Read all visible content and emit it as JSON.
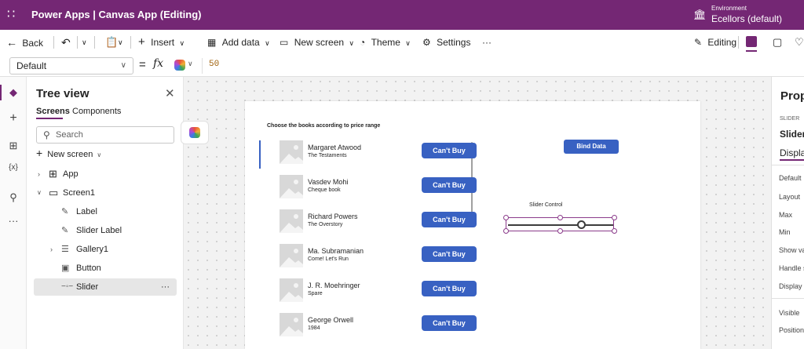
{
  "topbar": {
    "waffle_icon": "app-launcher-icon",
    "title": "Power Apps  |  Canvas App (Editing)",
    "environment_label": "Environment",
    "environment_name": "Ecellors (default)",
    "bg": "#742774"
  },
  "commandbar": {
    "back": "Back",
    "insert": "Insert",
    "add_data": "Add data",
    "new_screen": "New screen",
    "theme": "Theme",
    "settings": "Settings",
    "more": "···",
    "editing": "Editing"
  },
  "formulabar": {
    "property": "Default",
    "equals": "=",
    "fx": "fx",
    "value": "50"
  },
  "treeview": {
    "title": "Tree view",
    "tabs": [
      "Screens",
      "Components"
    ],
    "search_placeholder": "Search",
    "new_screen": "New screen",
    "nodes": [
      {
        "label": "App"
      },
      {
        "label": "Screen1"
      },
      {
        "label": "Label"
      },
      {
        "label": "Slider Label"
      },
      {
        "label": "Gallery1"
      },
      {
        "label": "Button"
      },
      {
        "label": "Slider"
      }
    ],
    "selected_more": "···"
  },
  "app": {
    "heading": "Choose the books according to price range",
    "bind_button": "Bind Data",
    "slider_label": "Slider Control",
    "slider_value_fraction": 0.7,
    "accent": "#3861c2",
    "rows": [
      {
        "author": "Margaret Atwood",
        "book": "The Testaments",
        "button": "Can't Buy"
      },
      {
        "author": "Vasdev Mohi",
        "book": "Cheque book",
        "button": "Can't Buy"
      },
      {
        "author": "Richard Powers",
        "book": "The Overstory",
        "button": "Can't Buy"
      },
      {
        "author": "Ma. Subramanian",
        "book": "Come! Let's Run",
        "button": "Can't Buy"
      },
      {
        "author": "J. R. Moehringer",
        "book": "Spare",
        "button": "Can't Buy"
      },
      {
        "author": "George Orwell",
        "book": "1984",
        "button": "Can't Buy"
      }
    ]
  },
  "properties": {
    "title": "Prop",
    "type_label": "SLIDER",
    "name": "Slider",
    "tab": "Display",
    "rows": [
      "Default",
      "Layout",
      "Max",
      "Min",
      "Show val",
      "Handle s",
      "Display r",
      "Visible",
      "Position"
    ]
  }
}
